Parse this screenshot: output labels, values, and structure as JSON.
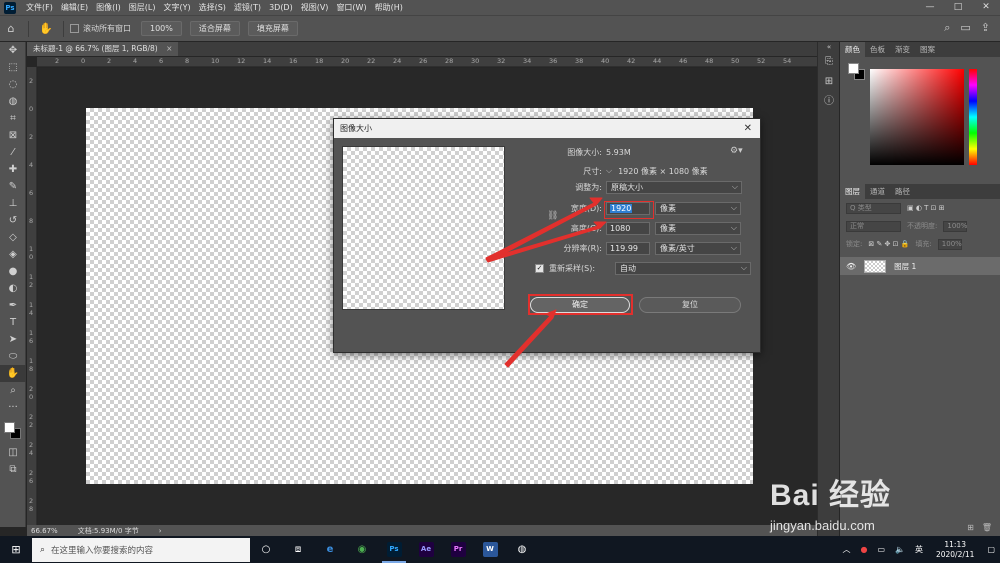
{
  "menubar": {
    "logo": "Ps",
    "items": [
      "文件(F)",
      "编辑(E)",
      "图像(I)",
      "图层(L)",
      "文字(Y)",
      "选择(S)",
      "滤镜(T)",
      "3D(D)",
      "视图(V)",
      "窗口(W)",
      "帮助(H)"
    ],
    "minimize": "—",
    "maximize": "□",
    "close": "✕"
  },
  "options": {
    "scroll_all_label": "滚动所有窗口",
    "zoom_value": "100%",
    "fit_screen": "适合屏幕",
    "fill_screen": "填充屏幕"
  },
  "document": {
    "tab_title": "未标题-1 @ 66.7% (图层 1, RGB/8)",
    "tab_close": "×",
    "ruler_top": [
      "2",
      "0",
      "2",
      "4",
      "6",
      "8",
      "10",
      "12",
      "14",
      "16",
      "18",
      "20",
      "22",
      "24",
      "26",
      "28",
      "30",
      "32",
      "34",
      "36",
      "38",
      "40",
      "42",
      "44",
      "46",
      "48",
      "50",
      "52",
      "54"
    ],
    "ruler_left": [
      "2",
      "0",
      "2",
      "4",
      "6",
      "8",
      "1 0",
      "1 2",
      "1 4",
      "1 6",
      "1 8",
      "2 0",
      "2 2",
      "2 4",
      "2 6",
      "2 8"
    ]
  },
  "status": {
    "zoom": "66.67%",
    "doc_info": "文档:5.93M/0 字节",
    "arrow": "›"
  },
  "panels": {
    "color_tabs": [
      "颜色",
      "色板",
      "渐变",
      "图案"
    ],
    "layer_tabs": [
      "图层",
      "通道",
      "路径"
    ],
    "filter_placeholder": "Q 类型",
    "blend_mode": "正常",
    "opacity_label": "不透明度:",
    "opacity_value": "100%",
    "lock_label": "锁定:",
    "fill_label": "填充:",
    "fill_value": "100%",
    "layer_name": "图层 1"
  },
  "dialog": {
    "title": "图像大小",
    "close": "✕",
    "image_size_label": "图像大小:",
    "image_size_value": "5.93M",
    "dimensions_label": "尺寸:",
    "dimensions_value": "1920 像素  ×  1080 像素",
    "fit_to_label": "调整为:",
    "fit_to_value": "原稿大小",
    "width_label": "宽度(D):",
    "width_value": "1920",
    "width_unit": "像素",
    "height_label": "高度(G):",
    "height_value": "1080",
    "height_unit": "像素",
    "resolution_label": "分辨率(R):",
    "resolution_value": "119.99",
    "resolution_unit": "像素/英寸",
    "resample_label": "重新采样(S):",
    "resample_value": "自动",
    "ok": "确定",
    "reset": "复位"
  },
  "taskbar": {
    "search_placeholder": "在这里输入你要搜索的内容",
    "apps": [
      "Ps",
      "Ae",
      "Pr"
    ],
    "ime": "英",
    "time": "11:13",
    "date": "2020/2/11"
  },
  "watermark": {
    "logo_text": "Bai 经验",
    "url": "jingyan.baidu.com"
  },
  "colors": {
    "accent_red": "#e2302d",
    "selection_blue": "#2f7fd2",
    "ps_blue": "#31a8ff"
  }
}
